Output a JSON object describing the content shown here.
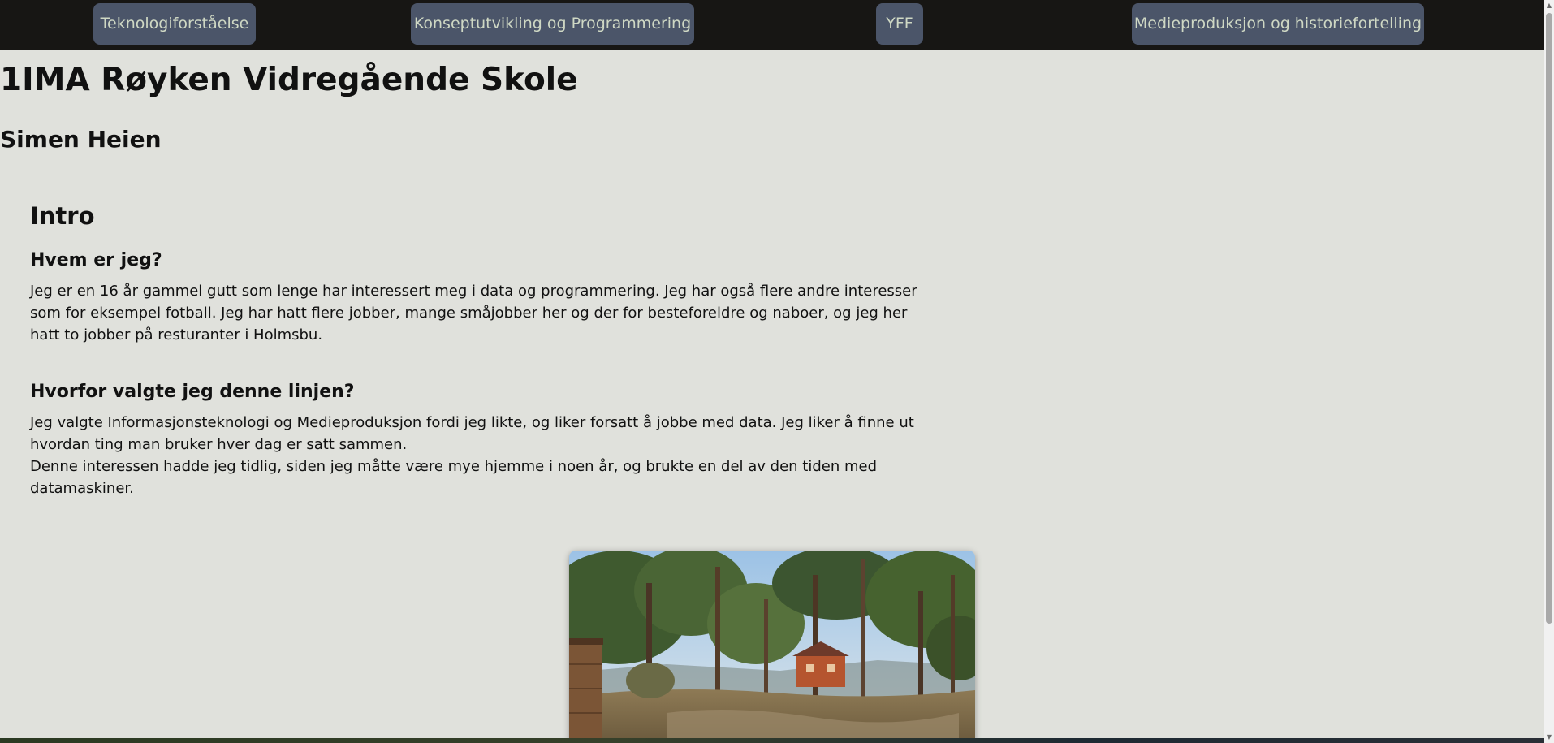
{
  "nav": {
    "items": [
      {
        "label": "Teknologiforståelse"
      },
      {
        "label": "Konseptutvikling og Programmering"
      },
      {
        "label": "YFF"
      },
      {
        "label": "Medieproduksjon og historiefortelling"
      }
    ]
  },
  "header": {
    "title": "1IMA Røyken Vidregående Skole",
    "author": "Simen Heien"
  },
  "main": {
    "section_title": "Intro",
    "q1": {
      "heading": "Hvem er jeg?",
      "text": "Jeg er en 16 år gammel gutt som lenge har interessert meg i data og programmering. Jeg har også flere andre interesser som for eksempel fotball. Jeg har hatt flere jobber, mange småjobber her og der for besteforeldre og naboer, og jeg her hatt to jobber på resturanter i Holmsbu."
    },
    "q2": {
      "heading": "Hvorfor valgte jeg denne linjen?",
      "text1": "Jeg valgte Informasjonsteknologi og Medieproduksjon fordi jeg likte, og liker forsatt å jobbe med data. Jeg liker å finne ut hvordan ting man bruker hver dag er satt sammen.",
      "text2": "Denne interessen hadde jeg tidlig, siden jeg måtte være mye hjemme i noen år, og brukte en del av den tiden med datamaskiner."
    }
  },
  "colors": {
    "page_background": "#e0e1dc",
    "nav_background": "#171614",
    "nav_button": "#4b5569",
    "nav_text": "#cfd8c4"
  },
  "icons": {
    "scroll_up": "scroll-up-arrow-icon",
    "scroll_down": "scroll-down-arrow-icon"
  }
}
